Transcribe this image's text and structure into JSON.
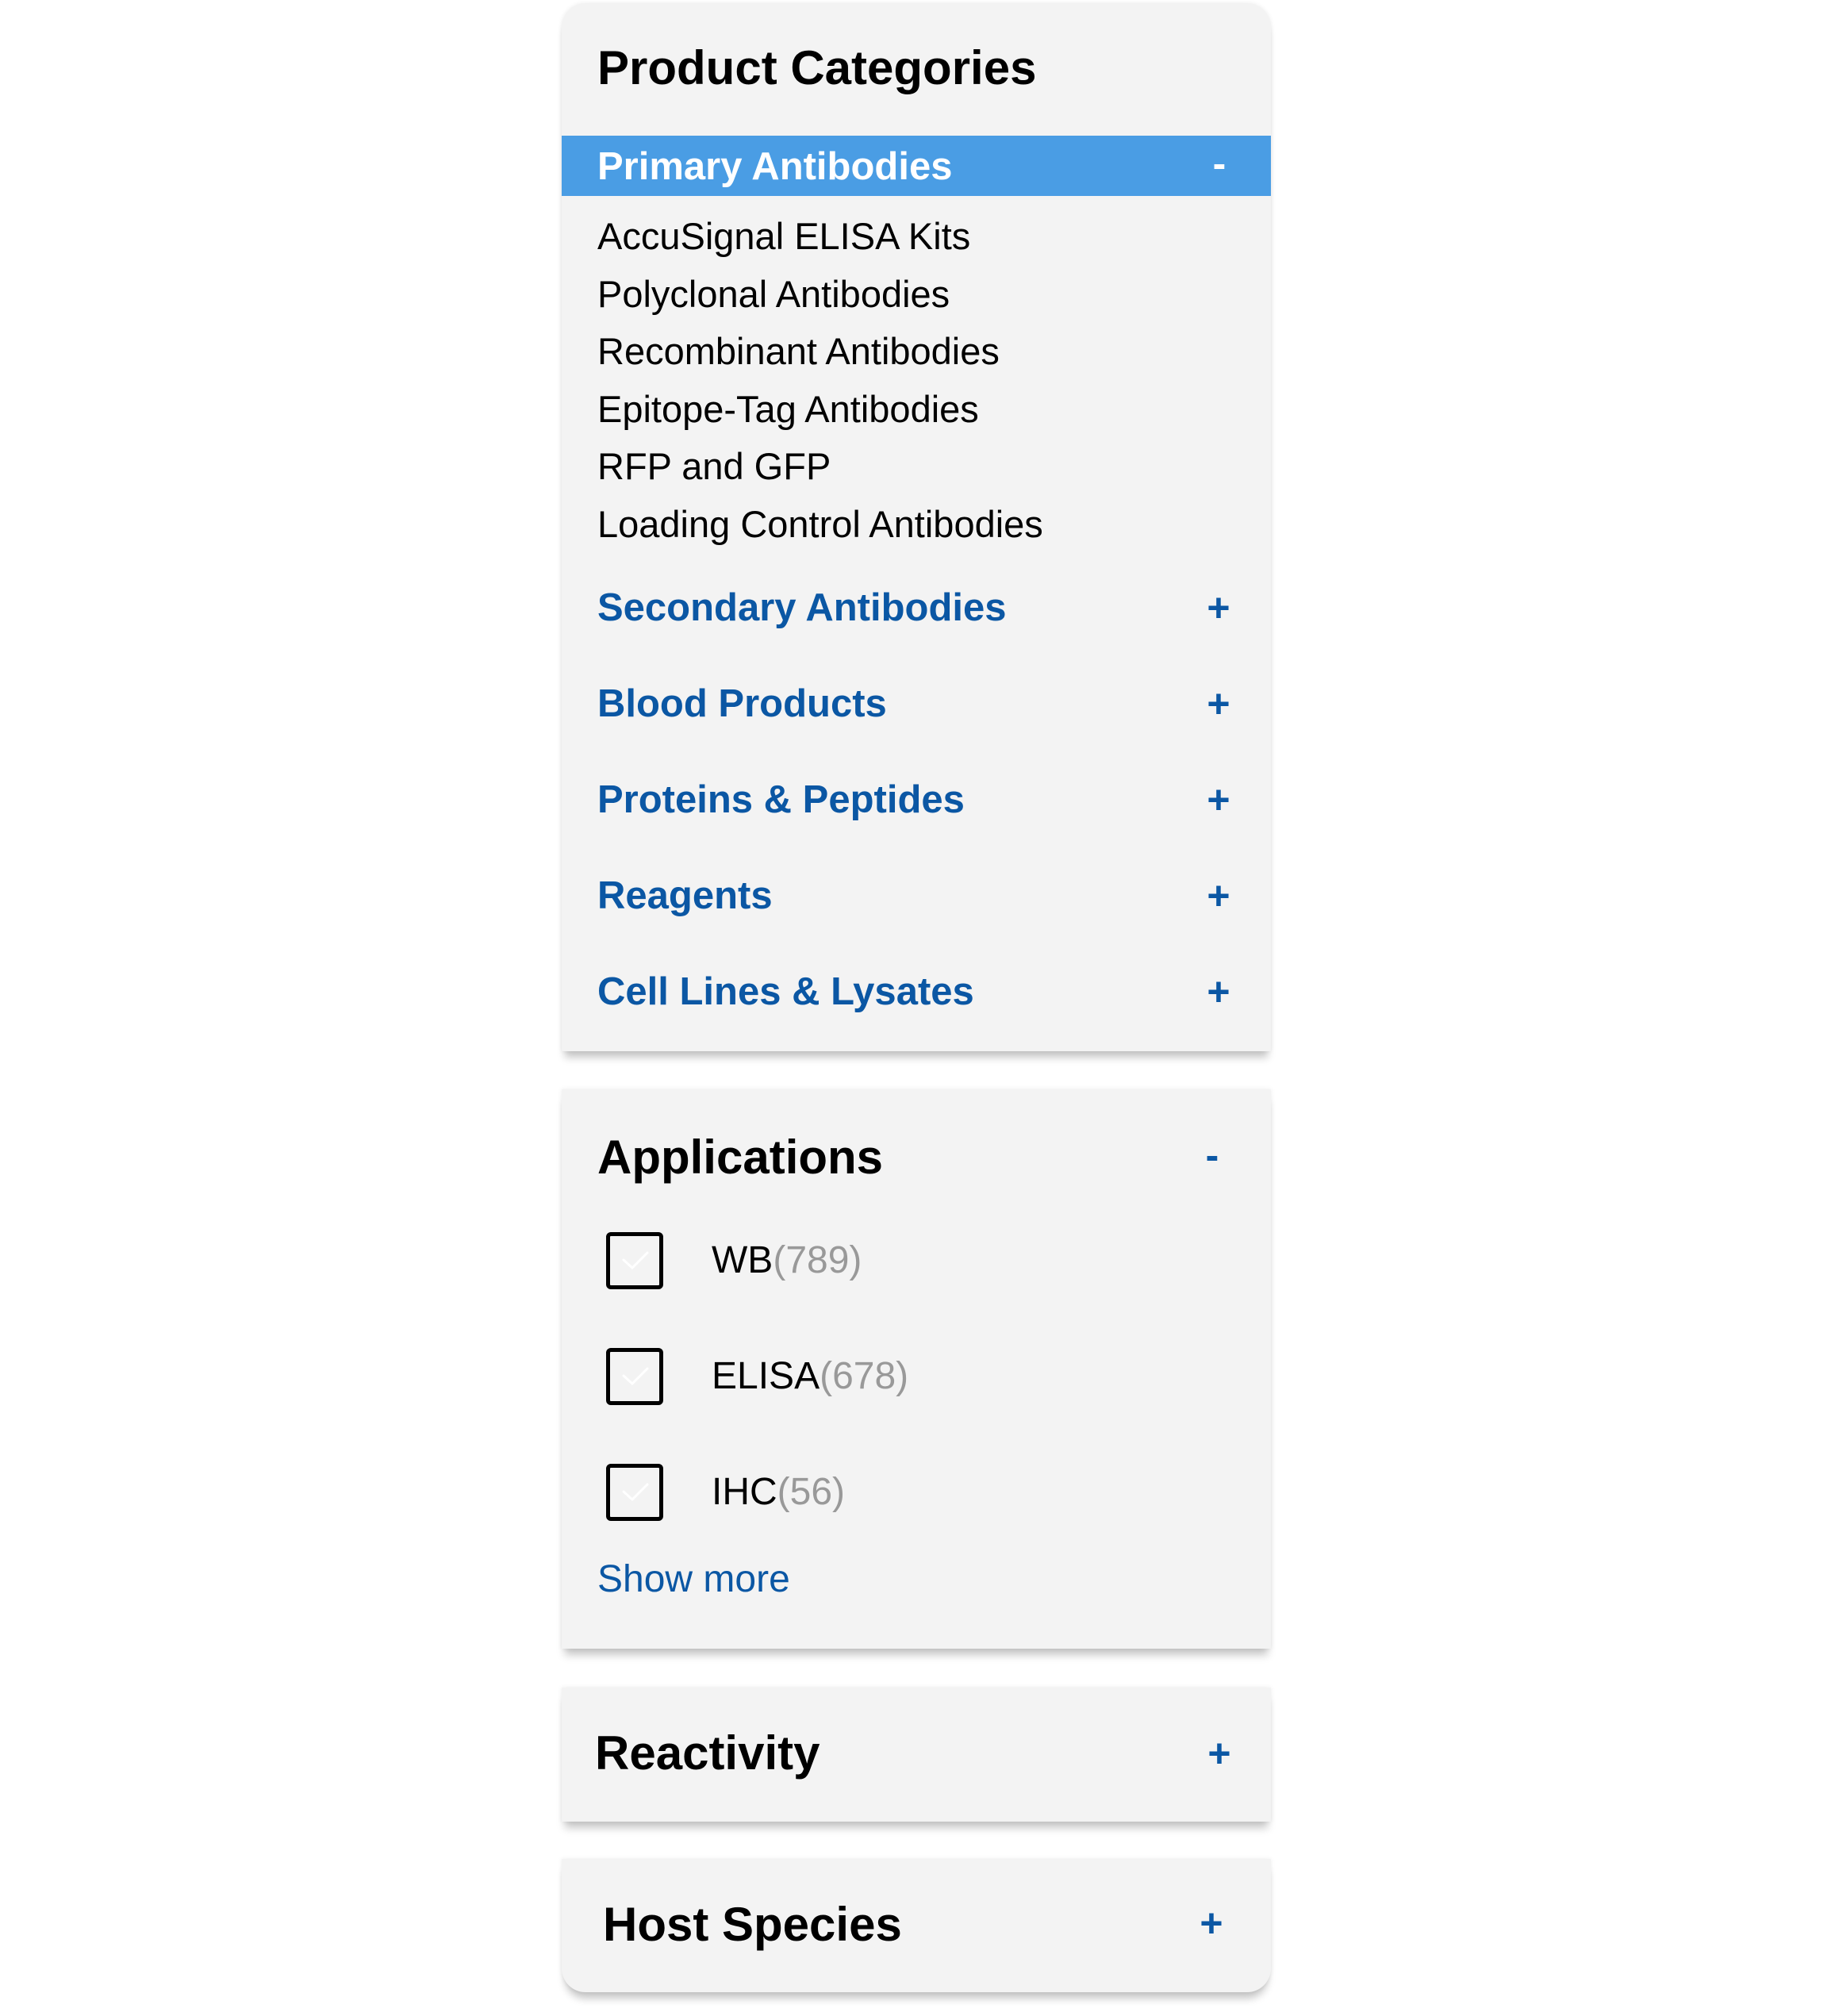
{
  "product_categories": {
    "title": "Product Categories",
    "active": {
      "label": "Primary Antibodies",
      "toggle": "-",
      "items": [
        "AccuSignal ELISA Kits",
        "Polyclonal Antibodies",
        "Recombinant Antibodies",
        "Epitope-Tag Antibodies",
        "RFP and GFP",
        "Loading Control Antibodies"
      ]
    },
    "collapsed": [
      {
        "label": "Secondary Antibodies",
        "toggle": "+"
      },
      {
        "label": "Blood Products",
        "toggle": "+"
      },
      {
        "label": "Proteins & Peptides",
        "toggle": "+"
      },
      {
        "label": "Reagents",
        "toggle": "+"
      },
      {
        "label": "Cell Lines & Lysates",
        "toggle": "+"
      }
    ]
  },
  "applications": {
    "title": "Applications",
    "toggle": "-",
    "options": [
      {
        "label": "WB",
        "count": "(789)",
        "checked": false
      },
      {
        "label": "ELISA",
        "count": "(678)",
        "checked": false
      },
      {
        "label": "IHC",
        "count": "(56)",
        "checked": false
      }
    ],
    "show_more": "Show more"
  },
  "reactivity": {
    "title": "Reactivity",
    "toggle": "+"
  },
  "host_species": {
    "title": "Host Species",
    "toggle": "+"
  },
  "colors": {
    "panel_bg": "#f3f3f3",
    "active_bg": "#4a9de4",
    "link_blue": "#0b57a4",
    "count_gray": "#999999"
  }
}
